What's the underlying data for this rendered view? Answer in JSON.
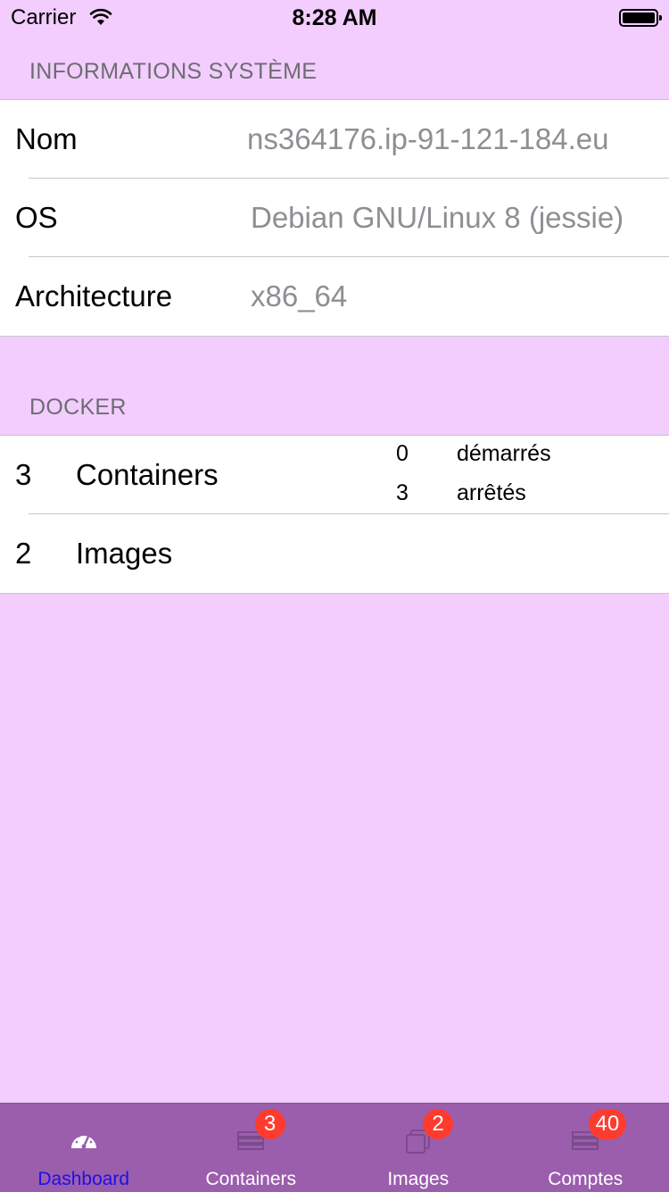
{
  "status_bar": {
    "carrier": "Carrier",
    "time": "8:28 AM"
  },
  "system_section": {
    "header": "INFORMATIONS SYSTÈME",
    "rows": [
      {
        "label": "Nom",
        "value": "ns364176.ip-91-121-184.eu"
      },
      {
        "label": "OS",
        "value": "Debian GNU/Linux 8 (jessie)"
      },
      {
        "label": "Architecture",
        "value": "x86_64"
      }
    ]
  },
  "docker_section": {
    "header": "DOCKER",
    "containers": {
      "count": "3",
      "label": "Containers",
      "started_count": "0",
      "started_label": "démarrés",
      "stopped_count": "3",
      "stopped_label": "arrêtés"
    },
    "images": {
      "count": "2",
      "label": "Images"
    }
  },
  "tab_bar": {
    "tabs": [
      {
        "label": "Dashboard",
        "icon": "dashboard-gauge-icon",
        "badge": "",
        "active": true
      },
      {
        "label": "Containers",
        "icon": "server-stack-icon",
        "badge": "3",
        "active": false
      },
      {
        "label": "Images",
        "icon": "stacked-squares-icon",
        "badge": "2",
        "active": false
      },
      {
        "label": "Comptes",
        "icon": "server-stack-icon",
        "badge": "40",
        "active": false
      }
    ]
  },
  "colors": {
    "background": "#f2cdfd",
    "tab_bar": "#9a5ead",
    "active_tab": "#1f0fe8",
    "badge": "#ff3b30",
    "secondary_text": "#8e8e93"
  }
}
